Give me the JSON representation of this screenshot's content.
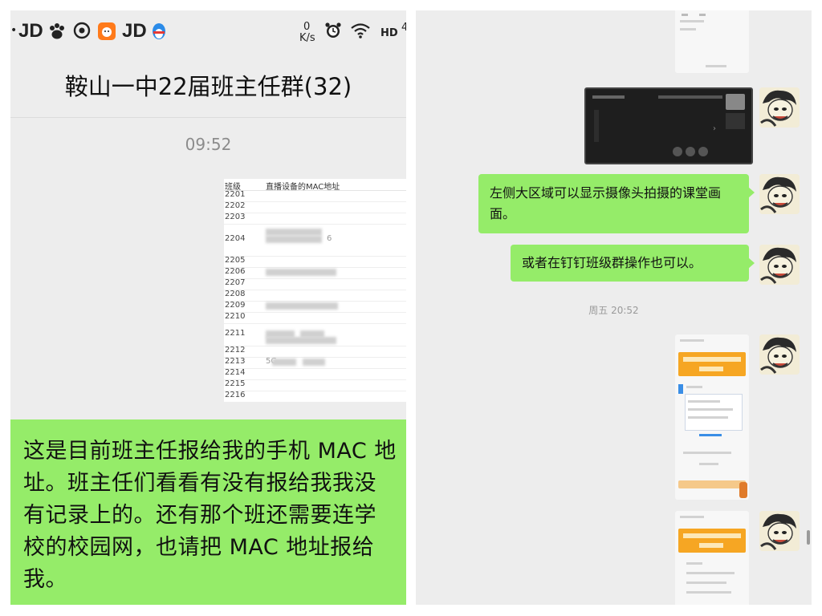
{
  "left": {
    "status_bar": {
      "left_icons": [
        "JD",
        "baidu-paw-icon",
        "weibo-icon",
        "app-face-icon",
        "JD",
        "qq-penguin-icon"
      ],
      "speed_value": "0",
      "speed_unit": "K/s",
      "hd": "HD",
      "signal": "4"
    },
    "chat_title": "鞍山一中22届班主任群(32)",
    "timestamp": "09:52",
    "sheet": {
      "col_class": "班级",
      "col_mac": "直播设备的MAC地址",
      "rows": [
        {
          "cls": "2201",
          "mac": ""
        },
        {
          "cls": "2202",
          "mac": ""
        },
        {
          "cls": "2203",
          "mac": ""
        },
        {
          "cls": "2204",
          "mac": "6"
        },
        {
          "cls": "2205",
          "mac": ""
        },
        {
          "cls": "2206",
          "mac": ""
        },
        {
          "cls": "2207",
          "mac": ""
        },
        {
          "cls": "2208",
          "mac": ""
        },
        {
          "cls": "2209",
          "mac": ""
        },
        {
          "cls": "2210",
          "mac": ""
        },
        {
          "cls": "2211",
          "mac": ""
        },
        {
          "cls": "2212",
          "mac": ""
        },
        {
          "cls": "2213",
          "mac": "5C"
        },
        {
          "cls": "2214",
          "mac": ""
        },
        {
          "cls": "2215",
          "mac": ""
        },
        {
          "cls": "2216",
          "mac": ""
        }
      ]
    },
    "message": "这是目前班主任报给我的手机 MAC 地址。班主任们看看有没有报给我我没有记录上的。还有那个班还需要连学校的校园网，也请把 MAC 地址报给我。"
  },
  "right": {
    "message_1": "左侧大区域可以显示摄像头拍摄的课堂画面。",
    "message_2": "或者在钉钉班级群操作也可以。",
    "timestamp": "周五 20:52"
  },
  "colors": {
    "bubble_green": "#95ec69",
    "chat_bg": "#ededed",
    "accent_orange": "#f6a623"
  }
}
